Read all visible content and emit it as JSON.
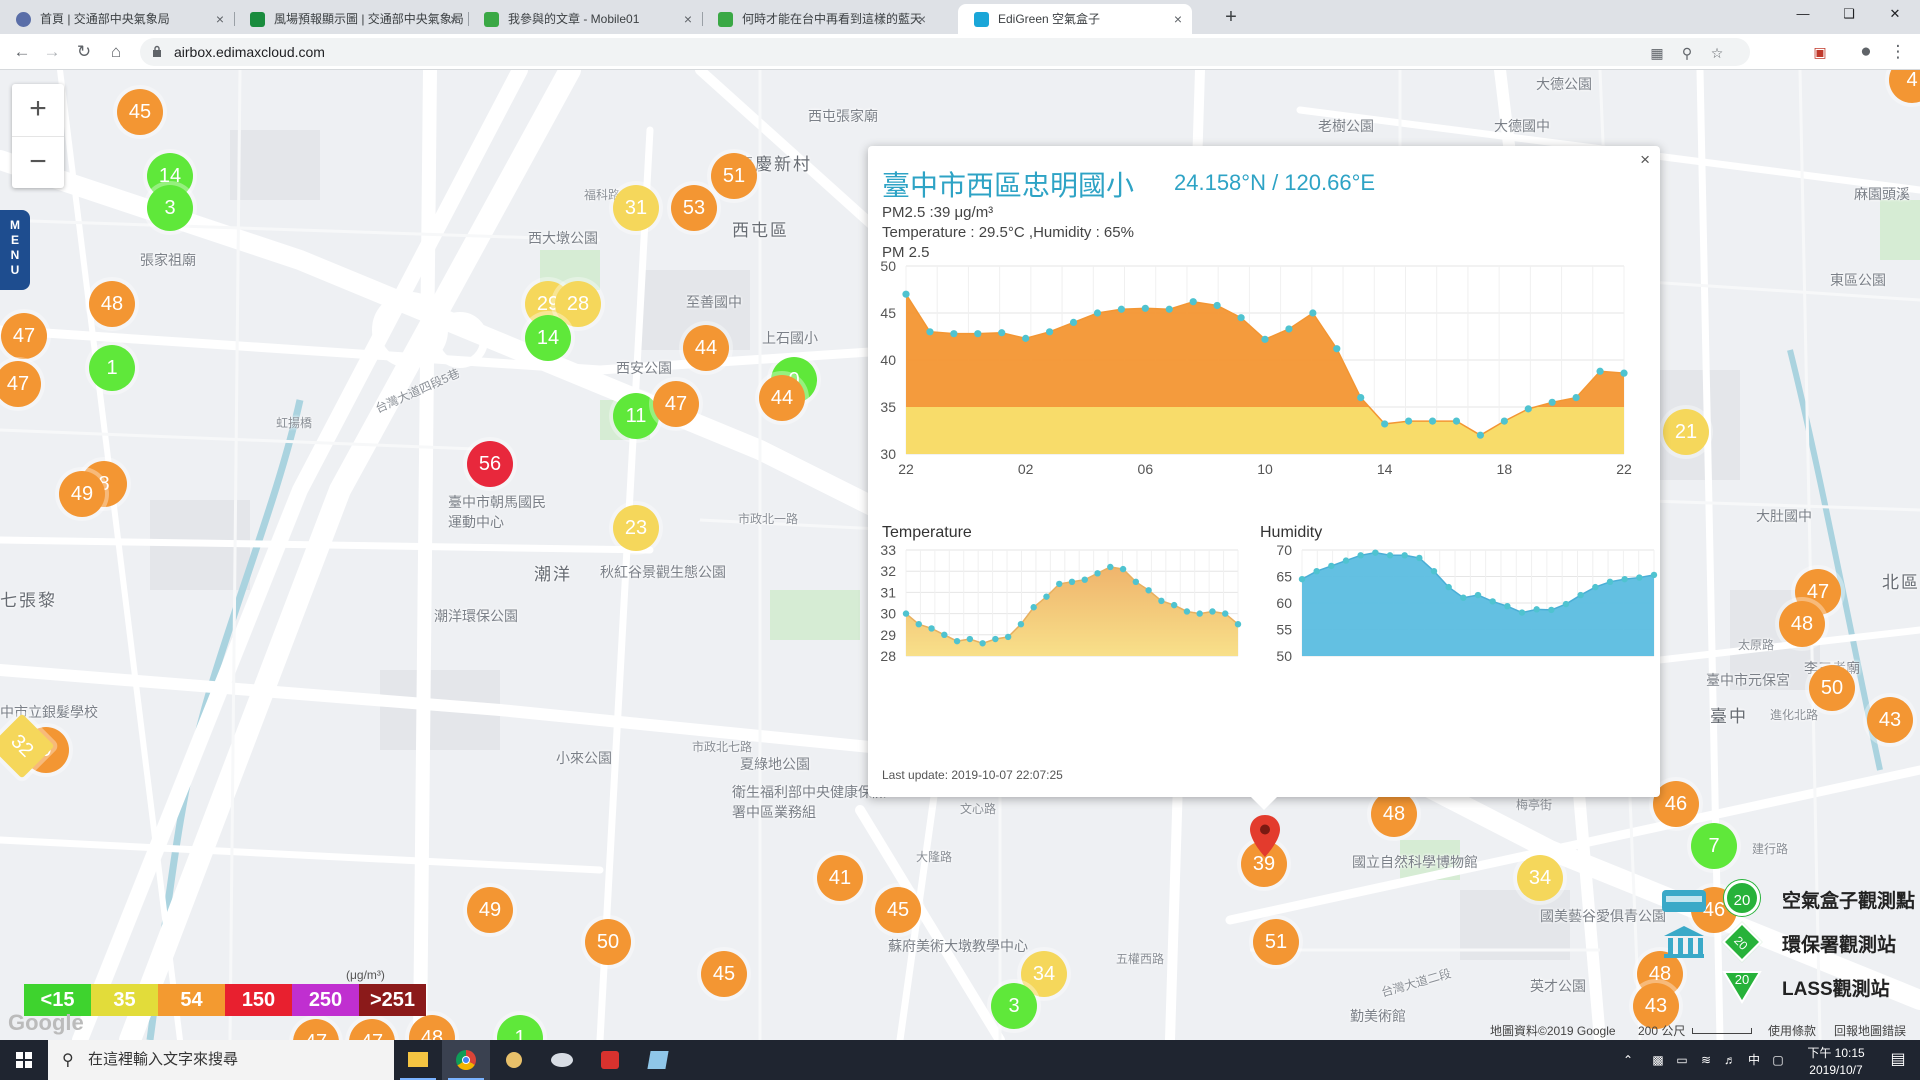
{
  "browser": {
    "tabs": [
      {
        "title": "首頁 | 交通部中央氣象局",
        "active": false
      },
      {
        "title": "風場預報顯示圖 | 交通部中央氣象局",
        "active": false
      },
      {
        "title": "我參與的文章 - Mobile01",
        "active": false
      },
      {
        "title": "何時才能在台中再看到這樣的藍天",
        "active": false
      },
      {
        "title": "EdiGreen 空氣盒子",
        "active": true
      }
    ],
    "url": "airbox.edimaxcloud.com",
    "new_tab_label": "+",
    "close_glyph": "×"
  },
  "map": {
    "zoom_in": "+",
    "zoom_out": "−",
    "menu_label": [
      "M",
      "E",
      "N",
      "U"
    ],
    "labels": [
      {
        "text": "西屯區",
        "cls": "big"
      },
      {
        "text": "潮洋",
        "cls": "big"
      },
      {
        "text": "臺中",
        "cls": "big"
      },
      {
        "text": "張家祖廟",
        "cls": ""
      },
      {
        "text": "西大墩公園",
        "cls": ""
      },
      {
        "text": "西安公園",
        "cls": ""
      },
      {
        "text": "至善國中",
        "cls": ""
      },
      {
        "text": "上石國小",
        "cls": ""
      },
      {
        "text": "臺中市朝馬國民運動中心",
        "cls": ""
      },
      {
        "text": "秋紅谷景觀生態公園",
        "cls": ""
      },
      {
        "text": "潮洋環保公園",
        "cls": ""
      },
      {
        "text": "小來公園",
        "cls": ""
      },
      {
        "text": "夏綠地公園",
        "cls": ""
      },
      {
        "text": "衛生福利部中央健康保險署中區業務組",
        "cls": ""
      },
      {
        "text": "國立自然科學博物館",
        "cls": ""
      },
      {
        "text": "蘇府美術大墩教學中心",
        "cls": ""
      },
      {
        "text": "國美藝谷愛俱青公園",
        "cls": ""
      },
      {
        "text": "西屯張家廟",
        "cls": ""
      },
      {
        "text": "老樹公園",
        "cls": ""
      },
      {
        "text": "大德國中",
        "cls": ""
      },
      {
        "text": "大德公園",
        "cls": ""
      },
      {
        "text": "中市立銀髮學校",
        "cls": ""
      },
      {
        "text": "七張黎",
        "cls": ""
      },
      {
        "text": "廣慶新村",
        "cls": ""
      },
      {
        "text": "福科路",
        "cls": "rd"
      },
      {
        "text": "虹揚橋",
        "cls": "rd"
      },
      {
        "text": "台灣大道四段5巷",
        "cls": "rd"
      },
      {
        "text": "市政北七路",
        "cls": "rd"
      },
      {
        "text": "市政北一路",
        "cls": "rd"
      },
      {
        "text": "大隆路",
        "cls": "rd"
      },
      {
        "text": "五權西路",
        "cls": "rd"
      },
      {
        "text": "英才公園",
        "cls": ""
      },
      {
        "text": "勤美術館",
        "cls": ""
      },
      {
        "text": "東區公園",
        "cls": ""
      },
      {
        "text": "麻園頭溪",
        "cls": ""
      },
      {
        "text": "進化北路",
        "cls": "rd"
      },
      {
        "text": "太原路",
        "cls": "rd"
      },
      {
        "text": "大肚國中",
        "cls": ""
      },
      {
        "text": "建行路",
        "cls": "rd"
      },
      {
        "text": "梅亭街",
        "cls": "rd"
      },
      {
        "text": "文心路",
        "cls": "rd"
      },
      {
        "text": "台灣大道二段",
        "cls": "rd"
      },
      {
        "text": "北區",
        "cls": "big"
      },
      {
        "text": "臺中市元保宮",
        "cls": ""
      },
      {
        "text": "李三考廟",
        "cls": ""
      }
    ],
    "markers": [
      {
        "v": "45",
        "c": "orange"
      },
      {
        "v": "14",
        "c": "green"
      },
      {
        "v": "3",
        "c": "green"
      },
      {
        "v": "48",
        "c": "orange"
      },
      {
        "v": "47",
        "c": "orange"
      },
      {
        "v": "1",
        "c": "green"
      },
      {
        "v": "47",
        "c": "orange"
      },
      {
        "v": "8",
        "c": "orange"
      },
      {
        "v": "49",
        "c": "orange"
      },
      {
        "v": "56",
        "c": "red"
      },
      {
        "v": "29",
        "c": "yellow"
      },
      {
        "v": "28",
        "c": "yellow"
      },
      {
        "v": "14",
        "c": "green"
      },
      {
        "v": "31",
        "c": "yellow"
      },
      {
        "v": "53",
        "c": "orange"
      },
      {
        "v": "51",
        "c": "orange"
      },
      {
        "v": "44",
        "c": "orange"
      },
      {
        "v": "11",
        "c": "green"
      },
      {
        "v": "47",
        "c": "orange"
      },
      {
        "v": "0",
        "c": "green"
      },
      {
        "v": "44",
        "c": "orange"
      },
      {
        "v": "23",
        "c": "yellow"
      },
      {
        "v": "9",
        "c": "orange"
      },
      {
        "v": "32",
        "c": "yellow"
      },
      {
        "v": "41",
        "c": "orange"
      },
      {
        "v": "45",
        "c": "orange"
      },
      {
        "v": "49",
        "c": "orange"
      },
      {
        "v": "50",
        "c": "orange"
      },
      {
        "v": "45",
        "c": "orange"
      },
      {
        "v": "34",
        "c": "yellow"
      },
      {
        "v": "3",
        "c": "green"
      },
      {
        "v": "39",
        "c": "orange"
      },
      {
        "v": "48",
        "c": "orange"
      },
      {
        "v": "51",
        "c": "orange"
      },
      {
        "v": "34",
        "c": "yellow"
      },
      {
        "v": "21",
        "c": "yellow"
      },
      {
        "v": "47",
        "c": "orange"
      },
      {
        "v": "48",
        "c": "orange"
      },
      {
        "v": "50",
        "c": "orange"
      },
      {
        "v": "43",
        "c": "orange"
      },
      {
        "v": "46",
        "c": "orange"
      },
      {
        "v": "7",
        "c": "green"
      },
      {
        "v": "46",
        "c": "orange"
      },
      {
        "v": "48",
        "c": "orange"
      },
      {
        "v": "43",
        "c": "orange"
      },
      {
        "v": "47",
        "c": "orange"
      },
      {
        "v": "47",
        "c": "orange"
      },
      {
        "v": "48",
        "c": "orange"
      },
      {
        "v": "1",
        "c": "green"
      },
      {
        "v": "4",
        "c": "orange"
      }
    ],
    "marker_colors": {
      "green": "#5fe83a",
      "yellow": "#f5d75b",
      "orange": "#f39633",
      "red": "#e8283c"
    },
    "legend": [
      {
        "label": "<15",
        "color": "#3ed32e"
      },
      {
        "label": "35",
        "color": "#e2dc3a"
      },
      {
        "label": "54",
        "color": "#f39a30"
      },
      {
        "label": "150",
        "color": "#e8202f"
      },
      {
        "label": "250",
        "color": "#c02fd0"
      },
      {
        "label": ">251",
        "color": "#8b1a1a"
      }
    ],
    "legend_unit": "(μg/m³)",
    "stations": [
      {
        "badge": "20",
        "label": "空氣盒子觀測點",
        "color": "#27b23a"
      },
      {
        "badge": "20",
        "label": "環保署觀測站",
        "color": "#27b23a"
      },
      {
        "badge": "20",
        "label": "LASS觀測站",
        "color": "#27b23a"
      }
    ],
    "attribution": "地圖資料©2019 Google",
    "scale": "200 公尺",
    "terms": "使用條款",
    "report": "回報地圖錯誤",
    "google": "Google"
  },
  "popup": {
    "title": "臺中市西區忠明國小",
    "coord": "24.158°N / 120.66°E",
    "pm25": "PM2.5 :39 μg/m³",
    "temp_hum": "Temperature : 29.5°C ,Humidity : 65%",
    "chart_title": "PM 2.5",
    "temp_title": "Temperature",
    "hum_title": "Humidity",
    "last_update": "Last update: 2019-10-07 22:07:25",
    "close": "×"
  },
  "chart_data": [
    {
      "type": "area",
      "title": "PM 2.5",
      "x_ticks": [
        "22",
        "02",
        "06",
        "10",
        "14",
        "18",
        "22"
      ],
      "y_ticks": [
        50,
        45,
        40,
        35,
        30
      ],
      "ylim": [
        30,
        50
      ],
      "values": [
        47,
        43,
        42.8,
        42.8,
        42.9,
        42.3,
        43,
        44,
        45,
        45.4,
        45.5,
        45.4,
        46.2,
        45.8,
        44.5,
        42.2,
        43.3,
        45,
        41.2,
        36,
        33.2,
        33.5,
        33.5,
        33.5,
        32,
        33.5,
        34.8,
        35.5,
        36,
        38.8,
        38.6
      ],
      "series": [
        {
          "name": "PM 2.5",
          "color": "#f39633"
        }
      ],
      "threshold": 35,
      "threshold_color": "#f8dc6a"
    },
    {
      "type": "area",
      "title": "Temperature",
      "y_ticks": [
        33,
        32,
        31,
        30,
        29,
        28
      ],
      "ylim": [
        28,
        33
      ],
      "values": [
        30,
        29.5,
        29.3,
        29,
        28.7,
        28.8,
        28.6,
        28.8,
        28.9,
        29.5,
        30.3,
        30.8,
        31.4,
        31.5,
        31.6,
        31.9,
        32.2,
        32.1,
        31.5,
        31.1,
        30.6,
        30.4,
        30.1,
        30,
        30.1,
        30,
        29.5
      ],
      "series": [
        {
          "name": "Temperature",
          "color": "#f0c07a"
        }
      ],
      "grid": true
    },
    {
      "type": "area",
      "title": "Humidity",
      "y_ticks": [
        70,
        65,
        60,
        55,
        50
      ],
      "ylim": [
        50,
        70
      ],
      "values": [
        64.5,
        66,
        67,
        68,
        69,
        69.5,
        69,
        69,
        68.5,
        66,
        63,
        61,
        61.5,
        60.3,
        59.4,
        58.2,
        58.8,
        58.7,
        59.8,
        61.5,
        63,
        64,
        64.5,
        64.8,
        65.3
      ],
      "series": [
        {
          "name": "Humidity",
          "color": "#5bbde0"
        }
      ],
      "grid": true
    }
  ],
  "taskbar": {
    "search_placeholder": "在這裡輸入文字來搜尋",
    "time": "下午 10:15",
    "date": "2019/10/7",
    "ime": "中"
  }
}
